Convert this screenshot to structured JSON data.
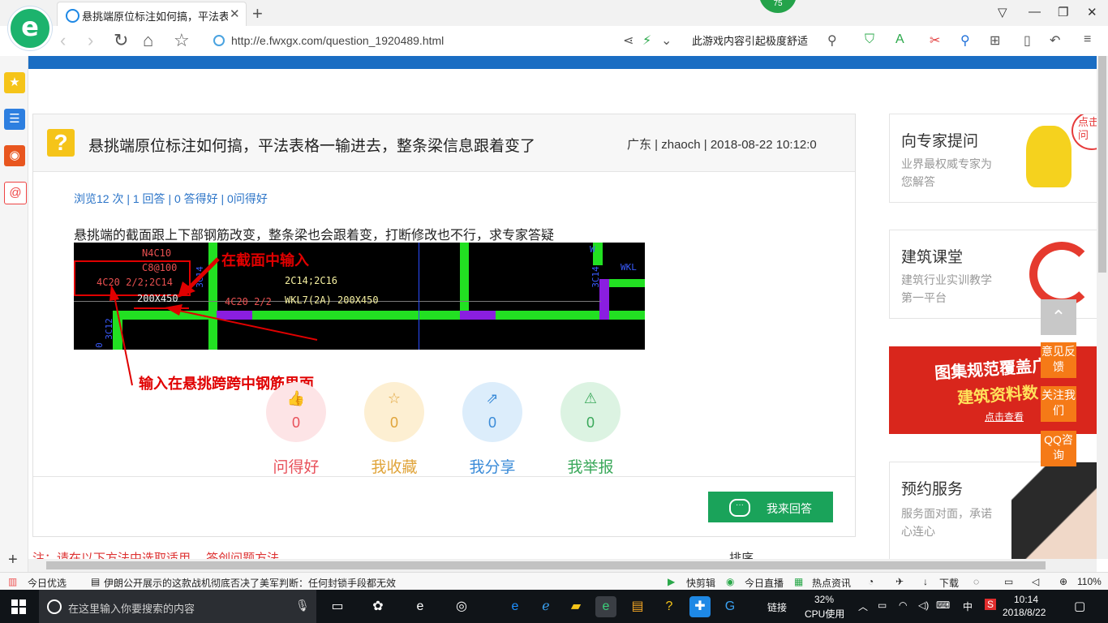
{
  "browser": {
    "tab_title": "悬挑端原位标注如何搞，平法表格",
    "badge": "75",
    "url": "http://e.fwxgx.com/question_1920489.html",
    "nav_right_text": "此游戏内容引起极度舒适"
  },
  "question": {
    "title": "悬挑端原位标注如何搞，平法表格一输进去，整条梁信息跟着变了",
    "meta": "广东 | zhaoch | 2018-08-22 10:12:0",
    "stats": "浏览12 次 | 1 回答 | 0 答得好 | 0问得好",
    "body": "悬挑端的截面跟上下部钢筋改变，整条梁也会跟着变，打断修改也不行，求专家答疑"
  },
  "cad": {
    "t_n4c10": "N4C10",
    "t_c8": "C8@100",
    "t_4c20a": "4C20 2/2;2C14",
    "t_200x450a": "200X450",
    "t_4c20b": "4C20 2/2",
    "t_2c14": "2C14;2C16",
    "t_wkl7": "WKL7(2A) 200X450",
    "t_wkl": "WKL",
    "t_3c12": "3C12",
    "t_3c14a": "3C14",
    "t_3c14b": "3C14",
    "t_w": "W",
    "t_o": "0",
    "note1": "在截面中输入",
    "note2": "输入在悬挑跨跨中钢筋里面"
  },
  "actions": [
    {
      "label": "问得好",
      "count": "0"
    },
    {
      "label": "我收藏",
      "count": "0"
    },
    {
      "label": "我分享",
      "count": "0"
    },
    {
      "label": "我举报",
      "count": "0"
    }
  ],
  "answer_button": "我来回答",
  "bottom_red": "注：请在以下方法中选取适用 ，答创问题方法。",
  "bottom_sort": "排序",
  "sidebar_right": {
    "expert": {
      "title": "向专家提问",
      "desc": "业界最权威专家为您解答",
      "bubble": "点击提问"
    },
    "course": {
      "title": "建筑课堂",
      "desc": "建筑行业实训教学第一平台"
    },
    "promo": {
      "line1": "图集规范覆盖广",
      "line2": "建筑资料数",
      "link": "点击查看"
    },
    "service": {
      "title": "预约服务",
      "desc": "服务面对面，承诺心连心"
    }
  },
  "float_buttons": [
    "意见反馈",
    "关注我们",
    "QQ咨询"
  ],
  "statusbar": {
    "today": "今日优选",
    "news": "伊朗公开展示的这款战机彻底否决了美军判断：任何封锁手段都无效",
    "kuaijian": "快剪辑",
    "live": "今日直播",
    "hot": "热点资讯",
    "download": "下载",
    "zoom": "110%"
  },
  "taskbar": {
    "search": "在这里输入你要搜索的内容",
    "links": "链接",
    "cpu_pct": "32%",
    "cpu_label": "CPU使用",
    "ime": "中",
    "time": "10:14",
    "date": "2018/8/22"
  }
}
